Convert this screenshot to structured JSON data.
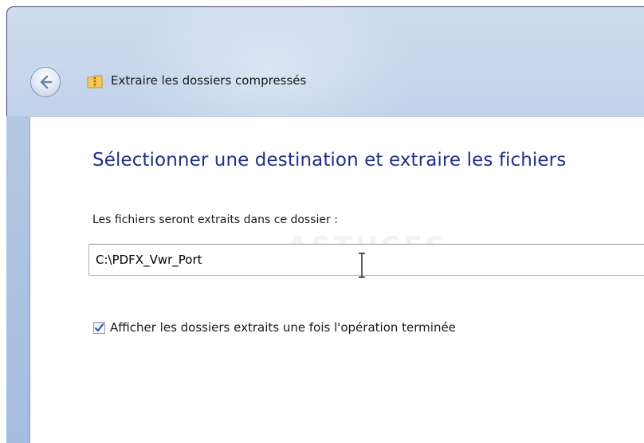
{
  "window": {
    "title": "Extraire les dossiers compressés"
  },
  "main": {
    "heading": "Sélectionner une destination et extraire les fichiers",
    "field_label": "Les fichiers seront extraits dans ce dossier :",
    "path_value": "C:\\PDFX_Vwr_Port",
    "checkbox_label": "Afficher les dossiers extraits une fois l'opération terminée",
    "checkbox_checked": true
  },
  "icons": {
    "back": "back-arrow-icon",
    "title": "zip-folder-icon",
    "checkbox": "checkmark-icon",
    "cursor": "text-cursor-icon"
  },
  "colors": {
    "heading": "#1e3287",
    "frame_glass": "#a9c0e3",
    "checkmark": "#2b5fb4"
  }
}
